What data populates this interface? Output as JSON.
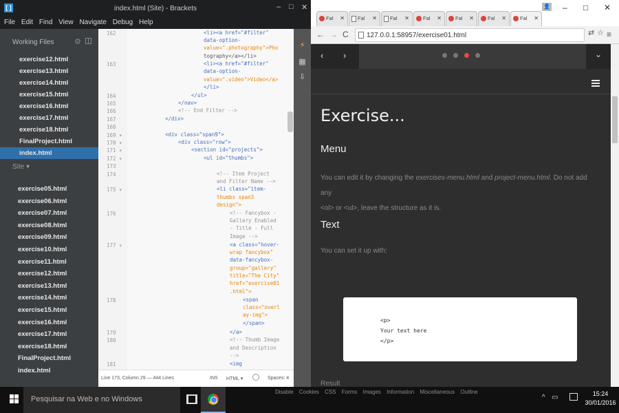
{
  "brackets": {
    "title": "index.html (Site) - Brackets",
    "menu": [
      "File",
      "Edit",
      "Find",
      "View",
      "Navigate",
      "Debug",
      "Help"
    ],
    "working_files_label": "Working Files",
    "working_files": [
      "exercise12.html",
      "exercise13.html",
      "exercise14.html",
      "exercise15.html",
      "exercise16.html",
      "exercise17.html",
      "exercise18.html",
      "FinalProject.html",
      "index.html"
    ],
    "active_file": "index.html",
    "site_label": "Site ▾",
    "site_files": [
      "exercise05.html",
      "exercise06.html",
      "exercise07.html",
      "exercise08.html",
      "exercise09.html",
      "exercise10.html",
      "exercise11.html",
      "exercise12.html",
      "exercise13.html",
      "exercise14.html",
      "exercise15.html",
      "exercise16.html",
      "exercise17.html",
      "exercise18.html",
      "FinalProject.html",
      "index.html"
    ],
    "line_numbers": [
      "162",
      "163",
      "164",
      "165",
      "166",
      "167",
      "168",
      "169 ▾",
      "170 ▾",
      "171 ▾",
      "172 ▾",
      "173",
      "174",
      "175 ▾",
      "176",
      "177 ▾",
      "178",
      "179",
      "180",
      "181"
    ],
    "code": {
      "l162a": "<li><a href=\"#filter\"",
      "l162b": "data-option-",
      "l162c": "value=\".photography\">Pho",
      "l162d": "tography</a></li>",
      "l163a": "<li><a href=\"#filter\"",
      "l163b": "data-option-",
      "l163c": "value=\".video\">Video</a>",
      "l163d": "</li>",
      "l164": "</ul>",
      "l165": "</nav>",
      "l166": "<!-- End Filter -->",
      "l167": "</div>",
      "l169": "<div class=\"span9\">",
      "l170": "<div class=\"row\">",
      "l171": "<section id=\"projects\">",
      "l172": "<ul id=\"thumbs\">",
      "l174a": "<!-- Item Project",
      "l174b": "and Filter Name -->",
      "l175a": "<li class=\"item-",
      "l175b": "thumbs span3",
      "l175c": "design\">",
      "l176a": "<!-- Fancybox -",
      "l176b": "Gallery Enabled",
      "l176c": "- Title - Full",
      "l176d": "Image -->",
      "l177a": "<a class=\"hover-",
      "l177b": "wrap fancybox\"",
      "l177c": "data-fancybox-",
      "l177d": "group=\"gallery\"",
      "l177e": "title=\"The City\"",
      "l177f": "href=\"exercise01",
      "l177g": ".html\">",
      "l178a": "<span",
      "l178b": "class=\"overl",
      "l178c": "ay-img\">",
      "l178d": "</span>",
      "l179": "</a>",
      "l180a": "<!-- Thumb Image",
      "l180b": "and Description",
      "l180c": "-->",
      "l181": "<img"
    },
    "status": {
      "cursor": "Line 173, Column 29 — 444 Lines",
      "ins": "INS",
      "mode": "HTML ▾",
      "spaces": "Spaces: 4"
    }
  },
  "chrome": {
    "tabs": [
      "Fal",
      "Fal",
      "Fal",
      "Fal",
      "Fal",
      "Fal",
      "Fal"
    ],
    "url": "127.0.0.1:58957/exercise01.html",
    "page": {
      "title": "Exercise...",
      "menu_heading": "Menu",
      "menu_text_1": "You can edit it by changing the ",
      "menu_file_1": "exercises-menu.html",
      "menu_text_2": " and ",
      "menu_file_2": "project-menu.html",
      "menu_text_3": ". Do not add any",
      "menu_text_4": "<ol> or <ul>, leave the structure as it is.",
      "text_heading": "Text",
      "text_body": "You can set it up with:",
      "code_sample": "<p>\nYour text here\n</p>",
      "result_label": "Result"
    }
  },
  "taskbar": {
    "search_placeholder": "Pesquisar na Web e no Windows",
    "bookmarks": [
      "Disable",
      "Cookies",
      "CSS",
      "Forms",
      "Images",
      "Information",
      "Miscellaneous",
      "Outline"
    ],
    "time": "15:24",
    "date": "30/01/2016"
  },
  "colors": {
    "active_file_bg": "#2f6fab",
    "slider_active_dot": "#e74c3c",
    "page_bg": "#2e2e2e"
  }
}
